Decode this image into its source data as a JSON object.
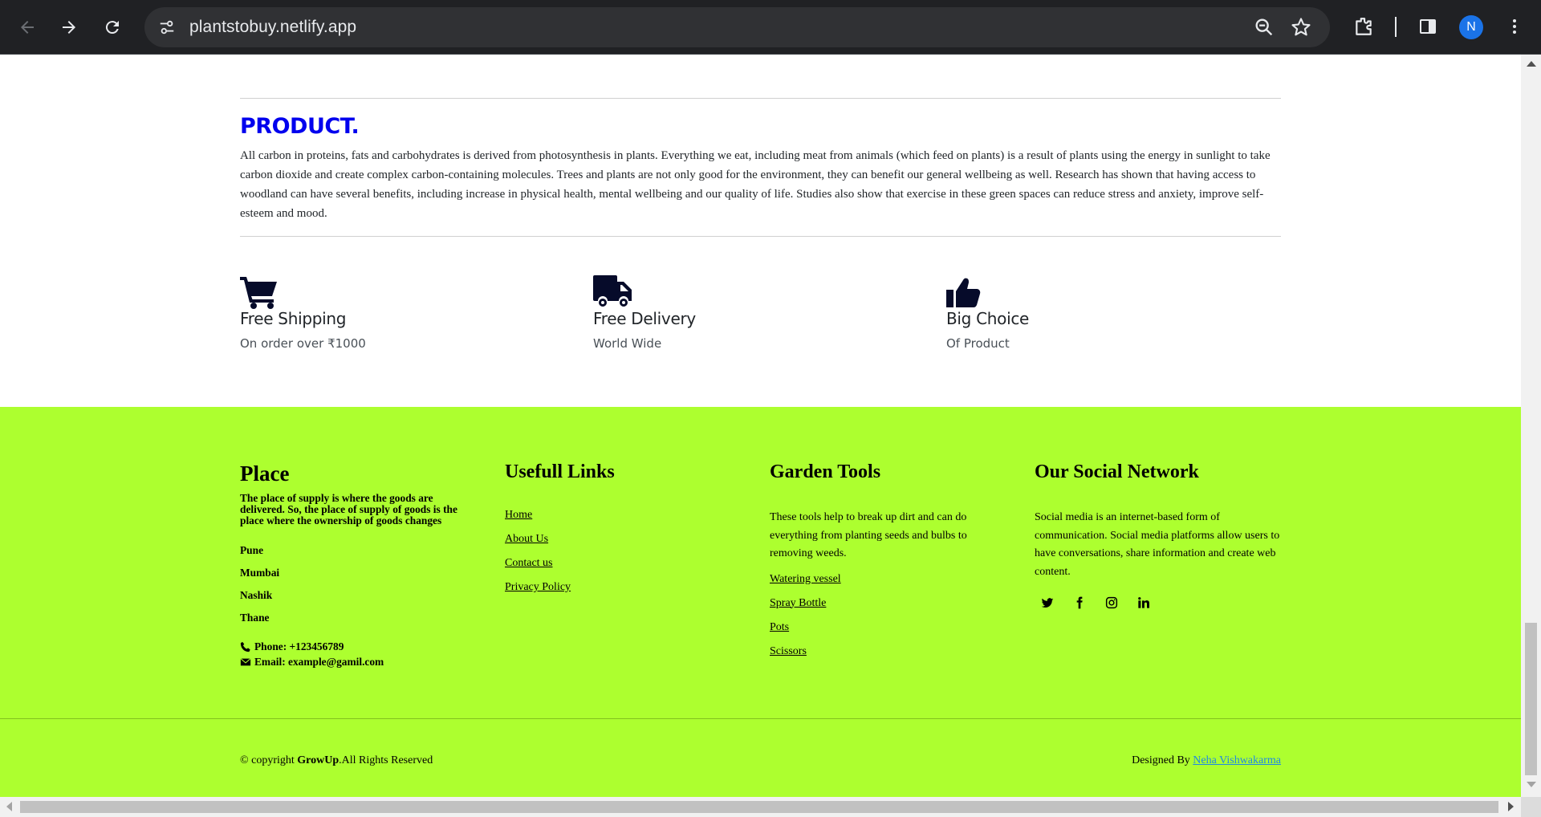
{
  "browser": {
    "url": "plantstobuy.netlify.app",
    "profile_initial": "N"
  },
  "product": {
    "title": "PRODUCT.",
    "text": "All carbon in proteins, fats and carbohydrates is derived from photosynthesis in plants. Everything we eat, including meat from animals (which feed on plants) is a result of plants using the energy in sunlight to take carbon dioxide and create complex carbon-containing molecules. Trees and plants are not only good for the environment, they can benefit our general wellbeing as well. Research has shown that having access to woodland can have several benefits, including increase in physical health, mental wellbeing and our quality of life. Studies also show that exercise in these green spaces can reduce stress and anxiety, improve self-esteem and mood."
  },
  "features": [
    {
      "icon": "cart-icon",
      "title": "Free Shipping",
      "subtitle": "On order over ₹1000"
    },
    {
      "icon": "truck-icon",
      "title": "Free Delivery",
      "subtitle": "World Wide"
    },
    {
      "icon": "thumbs-up-icon",
      "title": "Big Choice",
      "subtitle": "Of Product"
    }
  ],
  "footer": {
    "place": {
      "heading": "Place",
      "description": "The place of supply is where the goods are delivered. So, the place of supply of goods is the place where the ownership of goods changes",
      "cities": [
        "Pune",
        "Mumbai",
        "Nashik",
        "Thane"
      ],
      "phone": "Phone: +123456789",
      "email": "Email: example@gamil.com"
    },
    "links": {
      "heading": "Usefull Links",
      "items": [
        "Home",
        "About Us",
        "Contact us",
        "Privacy Policy"
      ]
    },
    "tools": {
      "heading": "Garden Tools",
      "description": "These tools help to break up dirt and can do everything from planting seeds and bulbs to removing weeds.",
      "items": [
        "Watering vessel",
        "Spray Bottle",
        "Pots",
        "Scissors"
      ]
    },
    "social": {
      "heading": "Our Social Network",
      "description": "Social media is an internet-based form of communication. Social media platforms allow users to have conversations, share information and create web content.",
      "icons": [
        "twitter-icon",
        "facebook-icon",
        "instagram-icon",
        "linkedin-icon"
      ]
    },
    "copyright_prefix": "© copyright ",
    "copyright_brand": "GrowUp",
    "copyright_suffix": ".All Rights Reserved",
    "designed_prefix": "Designed By ",
    "designer": "Neha Vishwakarma"
  },
  "colors": {
    "footer_bg": "#adff2f",
    "product_title": "#0000ee",
    "icon": "#060b2a"
  }
}
